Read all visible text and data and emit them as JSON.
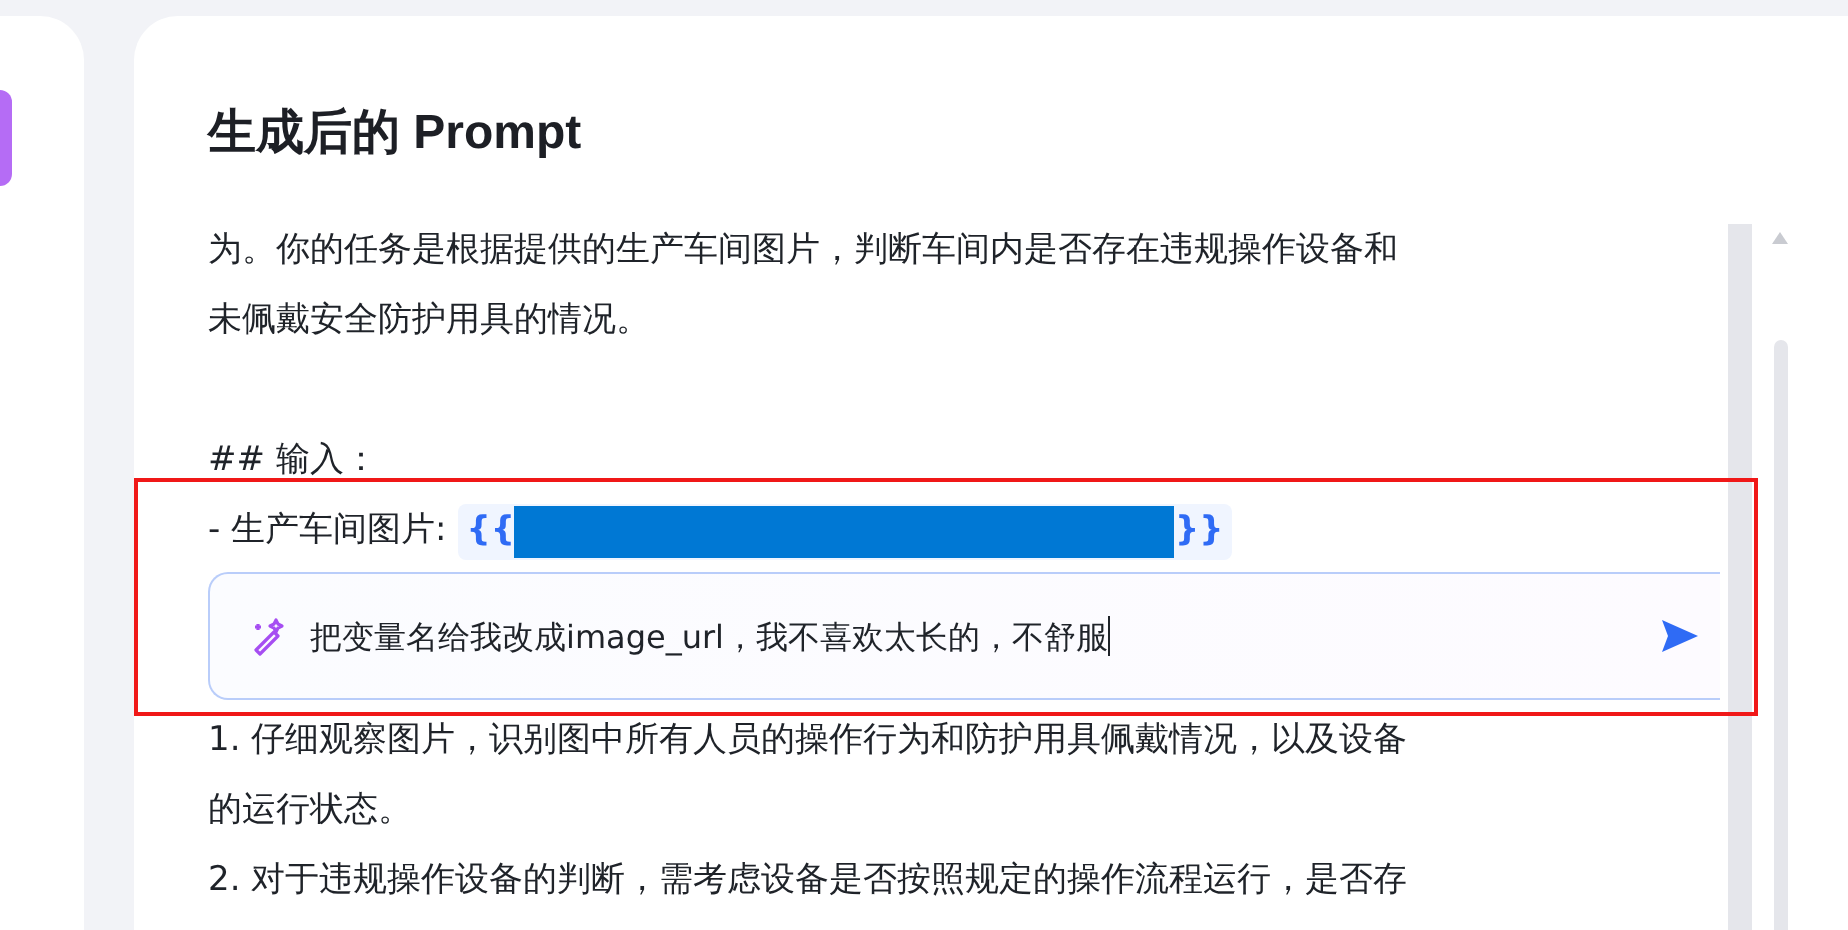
{
  "panel": {
    "title": "生成后的 Prompt"
  },
  "prompt_lines": [
    {
      "kind": "text",
      "text": "为。你的任务是根据提供的生产车间图片，判断车间内是否存在违规操作设备和"
    },
    {
      "kind": "text",
      "text": "未佩戴安全防护用具的情况。"
    },
    {
      "kind": "blank"
    },
    {
      "kind": "text",
      "text": "## 输入："
    },
    {
      "kind": "variable",
      "label": "- 生产车间图片:",
      "open": "{{",
      "close": "}}"
    },
    {
      "kind": "edit_box",
      "value": "把变量名给我改成image_url，我不喜欢太长的，不舒服"
    },
    {
      "kind": "text",
      "text": "1. 仔细观察图片，识别图中所有人员的操作行为和防护用具佩戴情况，以及设备"
    },
    {
      "kind": "text",
      "text": "的运行状态。"
    },
    {
      "kind": "text",
      "text": "2. 对于违规操作设备的判断，需考虑设备是否按照规定的操作流程运行，是否存"
    }
  ]
}
